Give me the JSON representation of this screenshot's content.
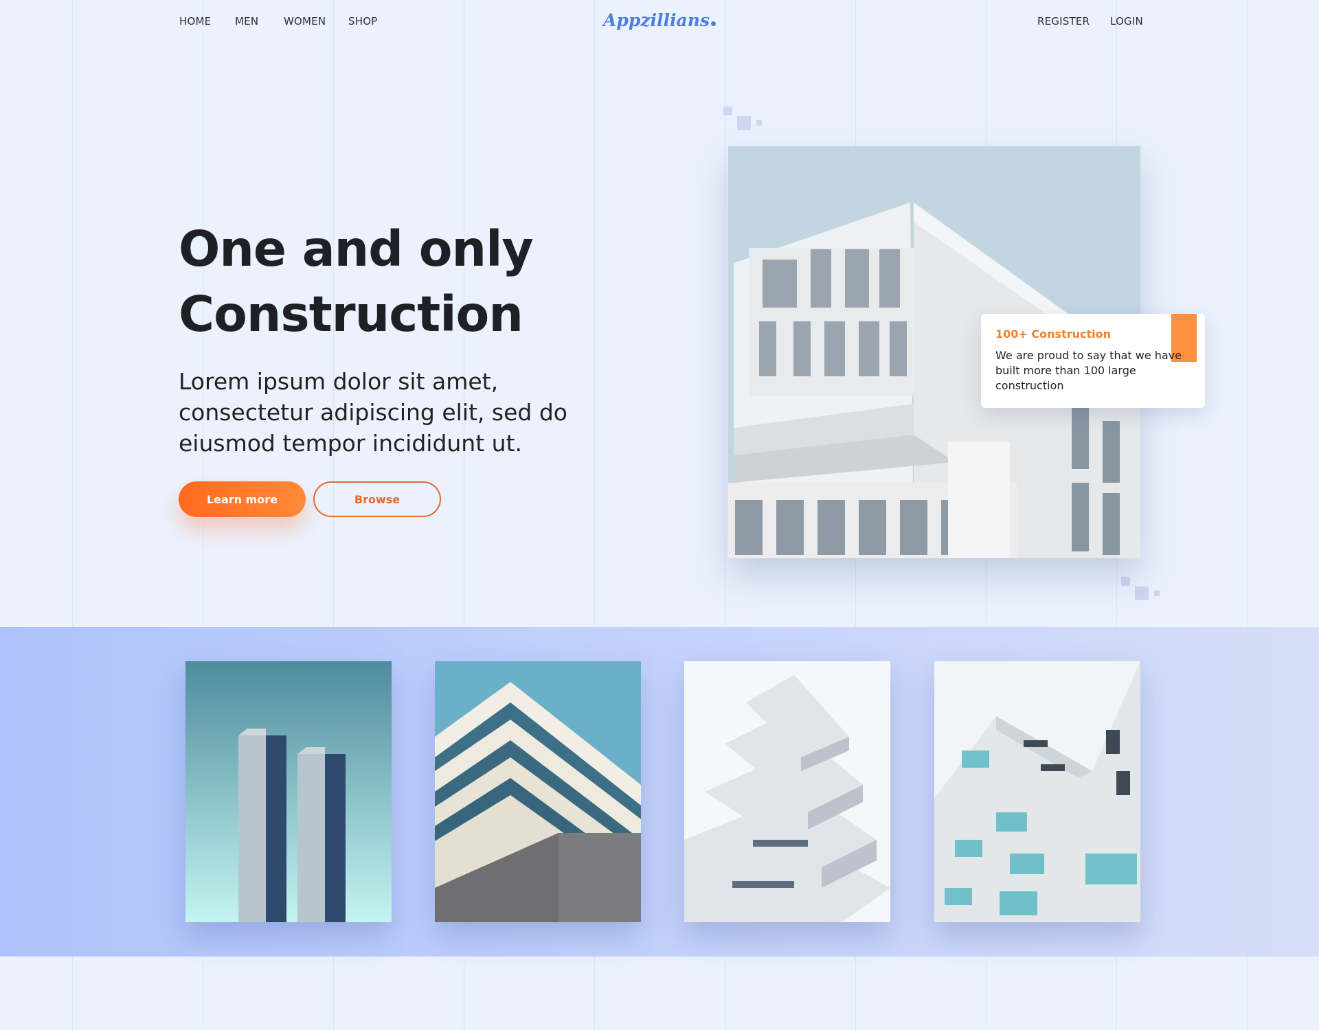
{
  "nav": {
    "left_items": [
      {
        "label": "HOME"
      },
      {
        "label": "MEN"
      },
      {
        "label": "WOMEN"
      },
      {
        "label": "SHOP"
      }
    ],
    "right_items": [
      {
        "label": "REGISTER"
      },
      {
        "label": "LOGIN"
      }
    ]
  },
  "brand": {
    "logo_text": "Appzillians",
    "color": "#4c7fdd"
  },
  "hero": {
    "title_line1": "One and only",
    "title_line2": "Construction",
    "subtitle": "Lorem ipsum dolor sit amet, consectetur adipiscing elit, sed do eiusmod tempor incididunt ut.",
    "primary_button": "Learn more",
    "secondary_button": "Browse",
    "accent_color": "#ff6a1e"
  },
  "info_card": {
    "title": "100+ Construction",
    "text": "We are proud to say that we have built more than 100 large construction",
    "accent_color": "#ff9040"
  },
  "gallery": {
    "items": [
      {
        "image": "twin-towers-photo"
      },
      {
        "image": "striped-building-photo"
      },
      {
        "image": "white-stacked-building-photo"
      },
      {
        "image": "balcony-building-photo"
      }
    ]
  }
}
